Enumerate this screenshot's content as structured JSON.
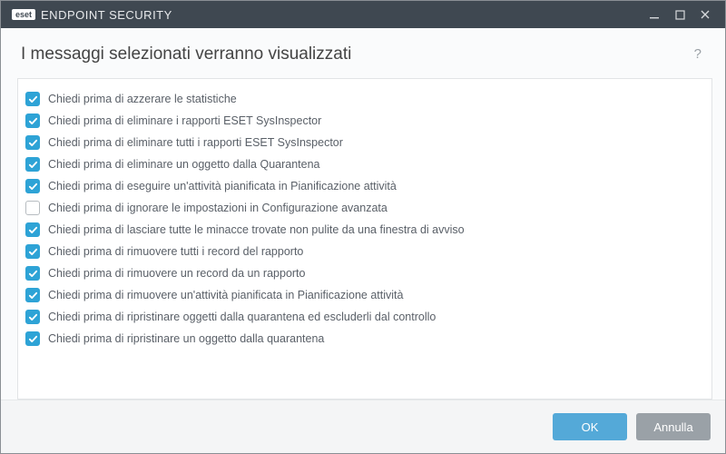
{
  "titlebar": {
    "brand_logo": "eset",
    "brand_text": "ENDPOINT SECURITY"
  },
  "header": {
    "title": "I messaggi selezionati verranno visualizzati",
    "help": "?"
  },
  "items": [
    {
      "checked": true,
      "label": "Chiedi prima di azzerare le statistiche"
    },
    {
      "checked": true,
      "label": "Chiedi prima di eliminare i rapporti ESET SysInspector"
    },
    {
      "checked": true,
      "label": "Chiedi prima di eliminare tutti i rapporti ESET SysInspector"
    },
    {
      "checked": true,
      "label": "Chiedi prima di eliminare un oggetto dalla Quarantena"
    },
    {
      "checked": true,
      "label": "Chiedi prima di eseguire un'attività pianificata in Pianificazione attività"
    },
    {
      "checked": false,
      "label": "Chiedi prima di ignorare le impostazioni in Configurazione avanzata"
    },
    {
      "checked": true,
      "label": "Chiedi prima di lasciare tutte le minacce trovate non pulite da una finestra di avviso"
    },
    {
      "checked": true,
      "label": "Chiedi prima di rimuovere tutti i record del rapporto"
    },
    {
      "checked": true,
      "label": "Chiedi prima di rimuovere un record da un rapporto"
    },
    {
      "checked": true,
      "label": "Chiedi prima di rimuovere un'attività pianificata in Pianificazione attività"
    },
    {
      "checked": true,
      "label": "Chiedi prima di ripristinare oggetti dalla quarantena ed escluderli dal controllo"
    },
    {
      "checked": true,
      "label": "Chiedi prima di ripristinare un oggetto dalla quarantena"
    }
  ],
  "footer": {
    "ok": "OK",
    "cancel": "Annulla"
  }
}
